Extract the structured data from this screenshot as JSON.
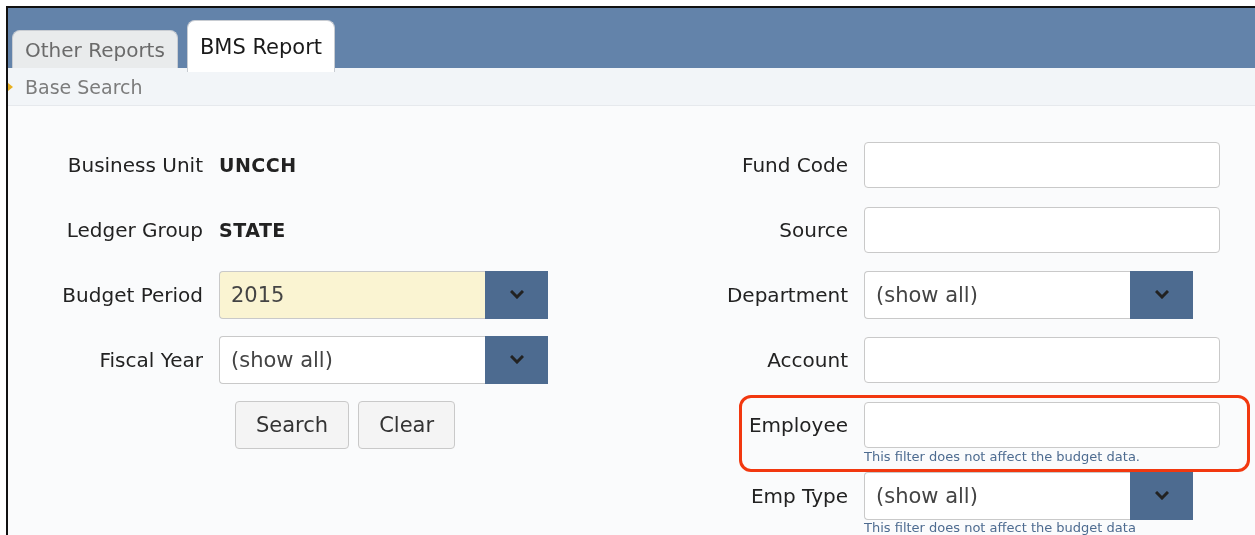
{
  "tabs": [
    {
      "label": "Other Reports",
      "selected": false
    },
    {
      "label": "BMS Report",
      "selected": true
    }
  ],
  "breadcrumb": "Base Search",
  "left_fields": [
    {
      "kind": "static",
      "label": "Business Unit",
      "value": "UNCCH"
    },
    {
      "kind": "static",
      "label": "Ledger Group",
      "value": "STATE"
    },
    {
      "kind": "select",
      "label": "Budget Period",
      "value": "2015",
      "required": true
    },
    {
      "kind": "select",
      "label": "Fiscal Year",
      "value": "(show all)",
      "required": false
    }
  ],
  "buttons": [
    "Search",
    "Clear"
  ],
  "right_fields": [
    {
      "kind": "text",
      "label": "Fund Code",
      "highlighted": false
    },
    {
      "kind": "text",
      "label": "Source",
      "highlighted": false
    },
    {
      "kind": "select",
      "label": "Department",
      "value": "(show all)",
      "highlighted": false
    },
    {
      "kind": "text",
      "label": "Account",
      "highlighted": false
    },
    {
      "kind": "text",
      "label": "Employee",
      "highlighted": true,
      "hint": "This filter does not affect the budget data."
    },
    {
      "kind": "select",
      "label": "Emp Type",
      "value": "(show all)",
      "highlighted": false,
      "hint": "This filter does not affect the budget data"
    }
  ]
}
